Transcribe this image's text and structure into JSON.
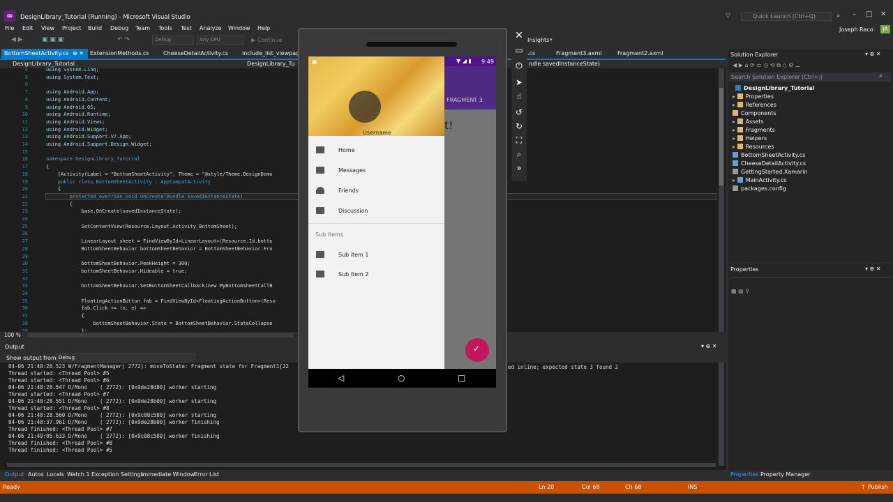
{
  "window": {
    "title": "DesignLibrary_Tutorial (Running) - Microsoft Visual Studio",
    "quick_launch": "Quick Launch (Ctrl+Q)",
    "user": "Joseph Raco",
    "user_initials": "JR",
    "insights": "Insights"
  },
  "menu": [
    "File",
    "Edit",
    "View",
    "Project",
    "Build",
    "Debug",
    "Team",
    "Tools",
    "Test",
    "Analyze",
    "Window",
    "Help"
  ],
  "toolbar": {
    "config": "Debug",
    "platform": "Any CPU",
    "continue": "Continue"
  },
  "tabs": [
    {
      "label": "BottomSheetActivity.cs"
    },
    {
      "label": "ExtensionMethods.cs"
    },
    {
      "label": "CheeseDetailActivity.cs"
    },
    {
      "label": "include_list_viewpager"
    },
    {
      "label": ".cs"
    },
    {
      "label": "Fragment3.axml"
    },
    {
      "label": "Fragment2.axml"
    }
  ],
  "nav": {
    "left": "DesignLibrary_Tutorial",
    "mid": "DesignLibrary_Tu",
    "right": "ndle savedInstanceState)"
  },
  "code_lines": [
    {
      "n": "4",
      "t": "using System.Linq;"
    },
    {
      "n": "5",
      "t": "using System.Text;"
    },
    {
      "n": "6",
      "t": ""
    },
    {
      "n": "7",
      "t": "using Android.App;"
    },
    {
      "n": "8",
      "t": "using Android.Content;"
    },
    {
      "n": "9",
      "t": "using Android.OS;"
    },
    {
      "n": "10",
      "t": "using Android.Runtime;"
    },
    {
      "n": "11",
      "t": "using Android.Views;"
    },
    {
      "n": "12",
      "t": "using Android.Widget;"
    },
    {
      "n": "13",
      "t": "using Android.Support.V7.App;"
    },
    {
      "n": "14",
      "t": "using Android.Support.Design.Widget;"
    },
    {
      "n": "15",
      "t": ""
    },
    {
      "n": "16",
      "t": "namespace DesignLibrary_Tutorial"
    },
    {
      "n": "17",
      "t": "{"
    },
    {
      "n": "18",
      "t": "    [Activity(Label = \"BottomSheetActivity\", Theme = \"@style/Theme.DesignDemo"
    },
    {
      "n": "19",
      "t": "    public class BottomSheetActivity : AppCompatActivity"
    },
    {
      "n": "20",
      "t": "    {"
    },
    {
      "n": "21",
      "t": "        protected override void OnCreate(Bundle savedInstanceState)"
    },
    {
      "n": "22",
      "t": "        {"
    },
    {
      "n": "23",
      "t": "            base.OnCreate(savedInstanceState);"
    },
    {
      "n": "24",
      "t": ""
    },
    {
      "n": "25",
      "t": "            SetContentView(Resource.Layout.Activity_BottomSheet);"
    },
    {
      "n": "26",
      "t": ""
    },
    {
      "n": "27",
      "t": "            LinearLayout sheet = FindViewById<LinearLayout>(Resource.Id.botto"
    },
    {
      "n": "28",
      "t": "            BottomSheetBehavior bottomSheetBehavior = BottomSheetBehavior.Fro"
    },
    {
      "n": "29",
      "t": ""
    },
    {
      "n": "30",
      "t": "            bottomSheetBehavior.PeekHeight = 300;"
    },
    {
      "n": "31",
      "t": "            bottomSheetBehavior.Hideable = true;"
    },
    {
      "n": "32",
      "t": ""
    },
    {
      "n": "33",
      "t": "            bottomSheetBehavior.SetBottomSheetCallback(new MyBottomSheetCallB"
    },
    {
      "n": "34",
      "t": ""
    },
    {
      "n": "35",
      "t": "            FloatingActionButton fab = FindViewById<FloatingActionButton>(Reso"
    },
    {
      "n": "36",
      "t": "            fab.Click += (o, e) =>"
    },
    {
      "n": "37",
      "t": "            {"
    },
    {
      "n": "38",
      "t": "                bottomSheetBehavior.State = BottomSheetBehavior.StateCollapse"
    },
    {
      "n": "39",
      "t": "            };"
    }
  ],
  "zoom": "100 %",
  "output": {
    "title": "Output",
    "show_from_label": "Show output from:",
    "source": "Debug",
    "lines": [
      "04-06 21:48:28.523 W/FragmentManager( 2772): moveToState: Fragment state for Fragment1{22",
      "Thread started: <Thread Pool> #5",
      "Thread started: <Thread Pool> #6",
      "04-06 21:48:28.547 D/Mono    ( 2772): [0x9de28d80] worker starting",
      "Thread started: <Thread Pool> #7",
      "04-06 21:48:28.551 D/Mono    ( 2772): [0x9de28b00] worker starting",
      "Thread started: <Thread Pool> #8",
      "04-06 21:48:28.560 D/Mono    ( 2772): [0x9c08c580] worker starting",
      "04-06 21:48:37.961 D/Mono    ( 2772): [0x9de28b00] worker finishing",
      "Thread finished: <Thread Pool> #7",
      "04-06 21:49:05.633 D/Mono    ( 2772): [0x9c08c580] worker finishing",
      "Thread finished: <Thread Pool> #8",
      "Thread finished: <Thread Pool> #5"
    ],
    "line_right": "ed inline; expected state 3 found 2"
  },
  "bottom_tabs": [
    "Output",
    "Autos",
    "Locals",
    "Watch 1",
    "Exception Settings",
    "Immediate Window",
    "Error List"
  ],
  "status": {
    "left": "Ready",
    "ln": "Ln 20",
    "col": "Col 68",
    "ch": "Ch 68",
    "ins": "INS",
    "publish": "Publish"
  },
  "solution_explorer": {
    "title": "Solution Explorer",
    "search": "Search Solution Explorer (Ctrl+;)",
    "project": "DesignLibrary_Tutorial",
    "items": [
      "Properties",
      "References",
      "Components",
      "Assets",
      "Fragments",
      "Helpers",
      "Resources",
      "BottomSheetActivity.cs",
      "CheeseDetailActivity.cs",
      "GettingStarted.Xamarin",
      "MainActivity.cs",
      "packages.config"
    ]
  },
  "properties": {
    "title": "Properties"
  },
  "right_tabs": [
    "Properties",
    "Property Manager"
  ],
  "phone": {
    "time": "9:49",
    "username": "Username",
    "tab_label": "FRAGMENT 3",
    "partial_text": "t!",
    "drawer_items": [
      "Home",
      "Messages",
      "Friends",
      "Discussion"
    ],
    "sub_header": "Sub items",
    "sub_items": [
      "Sub item 1",
      "Sub item 2"
    ]
  },
  "colors": {
    "accent": "#007acc",
    "status": "#ca5100",
    "fab": "#c2185b",
    "primary": "#4e2a84"
  }
}
